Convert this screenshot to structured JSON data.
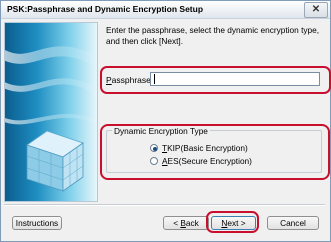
{
  "window": {
    "title": "PSK:Passphrase and Dynamic Encryption Setup",
    "close_glyph": "✕"
  },
  "instruction": "Enter the passphrase, select the dynamic encryption type, and then click [Next].",
  "passphrase": {
    "label_prefix": "",
    "label_mnemonic": "P",
    "label_rest": "assphrase:",
    "value": ""
  },
  "encryption": {
    "group_label": "Dynamic Encryption Type",
    "options": [
      {
        "mnemonic": "T",
        "rest": "KIP(Basic Encryption)",
        "selected": true
      },
      {
        "mnemonic": "A",
        "rest": "ES(Secure Encryption)",
        "selected": false
      }
    ]
  },
  "buttons": {
    "instructions": "Instructions",
    "back_prefix": "< ",
    "back_mnemonic": "B",
    "back_rest": "ack",
    "next_mnemonic": "N",
    "next_rest": "ext >",
    "cancel": "Cancel"
  },
  "colors": {
    "highlight": "#c8102e",
    "illustration_dark": "#0b5e8f",
    "illustration_light": "#e7f6fb"
  },
  "icons": {
    "illustration": "printer-network-cube-illustration"
  }
}
